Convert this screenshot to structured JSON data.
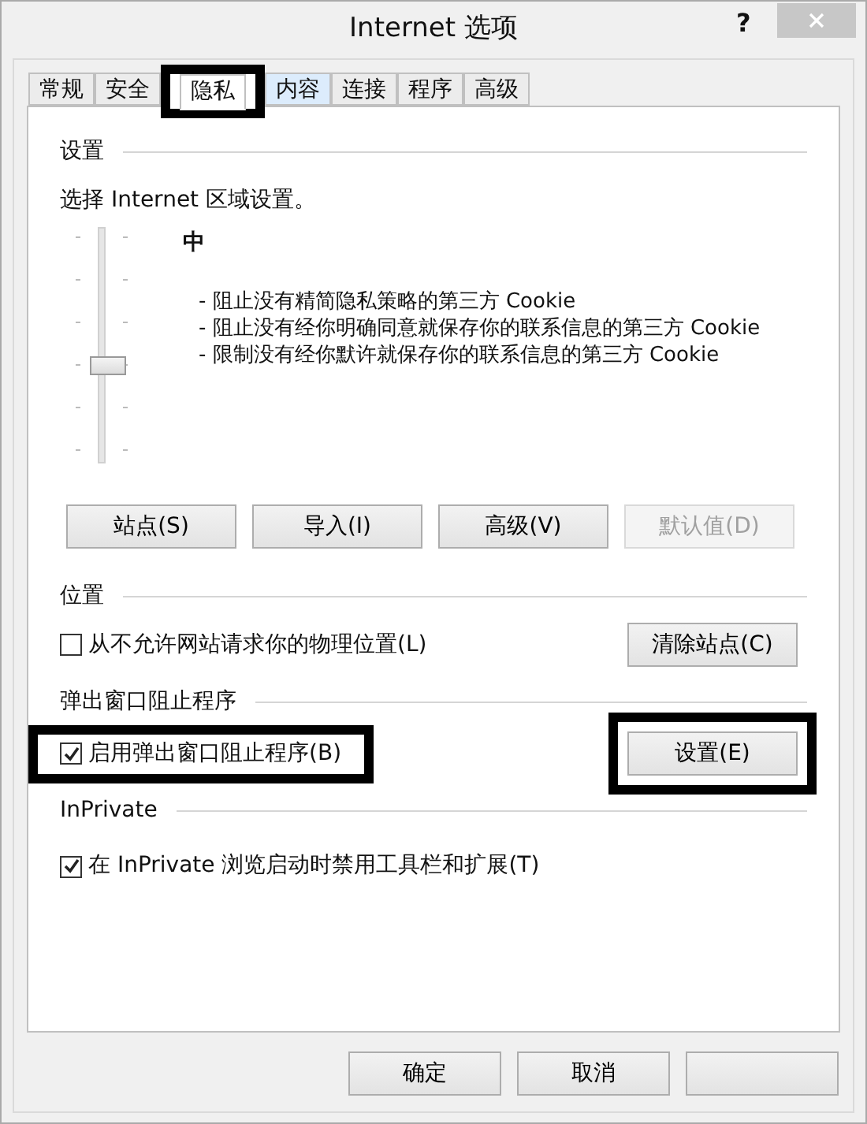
{
  "window": {
    "title": "Internet 选项",
    "help": "?"
  },
  "tabs": [
    {
      "label": "常规",
      "selected": false,
      "highlighted": false
    },
    {
      "label": "安全",
      "selected": false,
      "highlighted": false
    },
    {
      "label": "隐私",
      "selected": true,
      "highlighted": true
    },
    {
      "label": "内容",
      "selected": false,
      "hovered": true,
      "highlighted": false
    },
    {
      "label": "连接",
      "selected": false,
      "highlighted": false
    },
    {
      "label": "程序",
      "selected": false,
      "highlighted": false
    },
    {
      "label": "高级",
      "selected": false,
      "highlighted": false
    }
  ],
  "settings": {
    "heading": "设置",
    "prompt": "选择 Internet 区域设置。",
    "slider": {
      "level": 0.4
    },
    "level_name": "中",
    "bullets": [
      "- 阻止没有精简隐私策略的第三方 Cookie",
      "- 阻止没有经你明确同意就保存你的联系信息的第三方 Cookie",
      "- 限制没有经你默许就保存你的联系信息的第三方 Cookie"
    ],
    "buttons": [
      {
        "label": "站点(S)",
        "disabled": false
      },
      {
        "label": "导入(I)",
        "disabled": false
      },
      {
        "label": "高级(V)",
        "disabled": false
      },
      {
        "label": "默认值(D)",
        "disabled": true
      }
    ]
  },
  "location": {
    "heading": "位置",
    "checkbox": {
      "label": "从不允许网站请求你的物理位置(L)",
      "checked": false,
      "highlighted": false
    },
    "button": {
      "label": "清除站点(C)",
      "highlighted": false
    }
  },
  "popup": {
    "heading": "弹出窗口阻止程序",
    "checkbox": {
      "label": "启用弹出窗口阻止程序(B)",
      "checked": true,
      "highlighted": true
    },
    "button": {
      "label": "设置(E)",
      "highlighted": true
    }
  },
  "inprivate": {
    "heading": "InPrivate",
    "checkbox": {
      "label": "在 InPrivate 浏览启动时禁用工具栏和扩展(T)",
      "checked": true,
      "highlighted": false
    }
  },
  "footer_buttons": [
    "确定",
    "取消"
  ]
}
